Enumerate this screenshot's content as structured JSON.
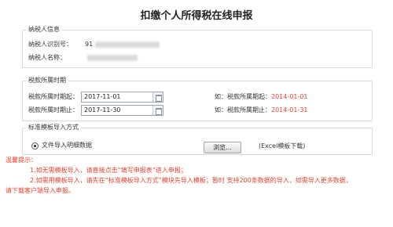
{
  "page": {
    "title": "扣缴个人所得税在线申报"
  },
  "taxpayer": {
    "section_title": "纳税人信息",
    "id_label": "纳税人识别号：",
    "id_value": "91",
    "name_label": "纳税人名称："
  },
  "period": {
    "section_title": "税款所属时期",
    "start_label": "税款所属时期起：",
    "start_value": "2017-11-01",
    "end_label": "税款所属时期止：",
    "end_value": "2017-11-30",
    "start_hint_prefix": "如：税款所属期起：",
    "start_hint_value": "2014-01-01",
    "end_hint_prefix": "如：税款所属期止：",
    "end_hint_value": "2014-01-31"
  },
  "import": {
    "section_title": "标准模板导入方式",
    "option_label": "文件导入明细数据",
    "browse_label": "浏览...",
    "template_link": "(Excel模板下载)"
  },
  "tips": {
    "heading": "温馨提示：",
    "line1": "1.如无需模板导入，请直接点击“填写申报表”进入申报；",
    "line2": "2.如需用模板导入，请先在“标准模板导入方式”模块先导入模板；暂时 支持200条数据的导入，如需导入更多数据，",
    "line3": "请下载客户端导入申报。"
  },
  "colors": {
    "accent_red": "#e8412f",
    "border": "#d9d9d9"
  }
}
